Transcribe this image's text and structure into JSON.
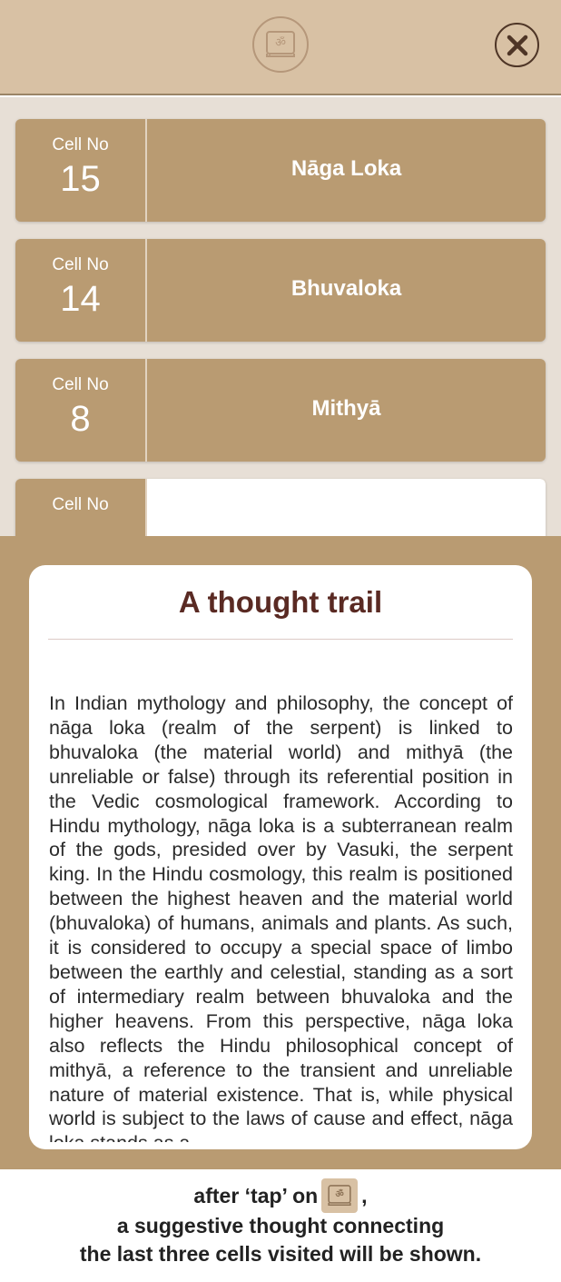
{
  "cells": [
    {
      "label": "Cell No",
      "number": "15",
      "name": "Nāga Loka"
    },
    {
      "label": "Cell No",
      "number": "14",
      "name": "Bhuvaloka"
    },
    {
      "label": "Cell No",
      "number": "8",
      "name": "Mithyā"
    },
    {
      "label": "Cell No",
      "number": "",
      "name": ""
    }
  ],
  "thought": {
    "title": "A thought trail",
    "body": "In Indian mythology and philosophy, the concept of nāga loka (realm of the serpent) is linked to bhuvaloka (the material world) and mithyā (the unreliable or false) through its referential position in the Vedic cosmological framework. According to Hindu mythology, nāga loka is a subterranean realm of the gods, presided over by Vasuki, the serpent king. In the Hindu cosmology, this realm is positioned between the highest heaven and the material world (bhuvaloka) of humans, animals and plants. As such, it is considered to occupy a special space of limbo between the earthly and celestial, standing as a sort of intermediary realm between bhuvaloka and the higher heavens. From this perspective, nāga loka also reflects the Hindu philosophical concept of mithyā, a reference to the transient and unreliable nature of material existence. That is, while physical world is subject to the laws of cause and effect, nāga loka stands as a"
  },
  "caption": {
    "line1_before": "after ‘tap’ on",
    "line1_after": ",",
    "line2": "a suggestive thought connecting",
    "line3": "the last three cells visited will be shown."
  },
  "icons": {
    "logo": "om-book-icon",
    "close": "close-icon"
  },
  "colors": {
    "header_bg": "#d8c1a4",
    "card_bg": "#b99b72",
    "title_color": "#5a2a23"
  }
}
